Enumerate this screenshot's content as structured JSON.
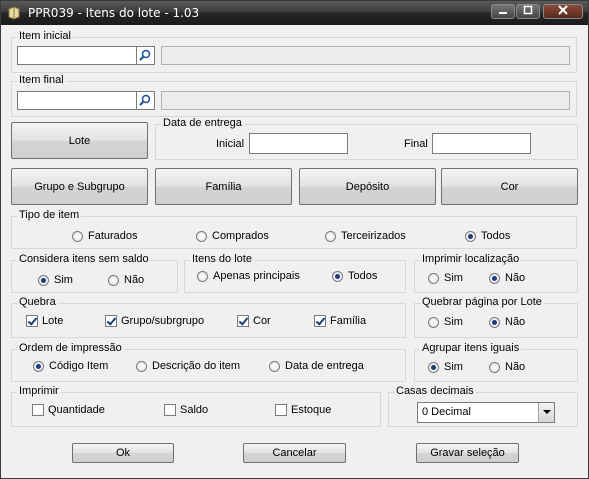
{
  "window": {
    "title": "PPR039 - Itens do lote - 1.03"
  },
  "item_inicial": {
    "label": "Item inicial",
    "value": "",
    "description": ""
  },
  "item_final": {
    "label": "Item final",
    "value": "",
    "description": ""
  },
  "lote_button": "Lote",
  "data_entrega": {
    "label": "Data de entrega",
    "inicial_label": "Inicial",
    "inicial_value": "",
    "final_label": "Final",
    "final_value": ""
  },
  "filter_buttons": [
    "Grupo e Subgrupo",
    "Família",
    "Depósito",
    "Cor"
  ],
  "tipo_item": {
    "label": "Tipo de item",
    "options": [
      "Faturados",
      "Comprados",
      "Terceirizados",
      "Todos"
    ],
    "selected": "Todos"
  },
  "considera_sem_saldo": {
    "label": "Considera itens sem saldo",
    "options": [
      "Sim",
      "Não"
    ],
    "selected": "Sim"
  },
  "itens_lote": {
    "label": "Itens do lote",
    "options": [
      "Apenas principais",
      "Todos"
    ],
    "selected": "Todos"
  },
  "imprimir_localizacao": {
    "label": "Imprimir localização",
    "options": [
      "Sim",
      "Não"
    ],
    "selected": "Não"
  },
  "quebra": {
    "label": "Quebra",
    "items": [
      {
        "label": "Lote",
        "checked": true
      },
      {
        "label": "Grupo/subrgrupo",
        "checked": true
      },
      {
        "label": "Cor",
        "checked": true
      },
      {
        "label": "Família",
        "checked": true
      }
    ]
  },
  "quebrar_pagina": {
    "label": "Quebrar página por Lote",
    "options": [
      "Sim",
      "Não"
    ],
    "selected": "Não"
  },
  "ordem_impressao": {
    "label": "Ordem de impressão",
    "options": [
      "Código Item",
      "Descrição do item",
      "Data de entrega"
    ],
    "selected": "Código Item"
  },
  "agrupar_itens": {
    "label": "Agrupar itens iguais",
    "options": [
      "Sim",
      "Não"
    ],
    "selected": "Sim"
  },
  "imprimir": {
    "label": "Imprimir",
    "items": [
      {
        "label": "Quantidade",
        "checked": false
      },
      {
        "label": "Saldo",
        "checked": false
      },
      {
        "label": "Estoque",
        "checked": false
      }
    ]
  },
  "casas_decimais": {
    "label": "Casas decimais",
    "selected": "0 Decimal"
  },
  "footer": {
    "ok": "Ok",
    "cancelar": "Cancelar",
    "gravar": "Gravar seleção"
  }
}
